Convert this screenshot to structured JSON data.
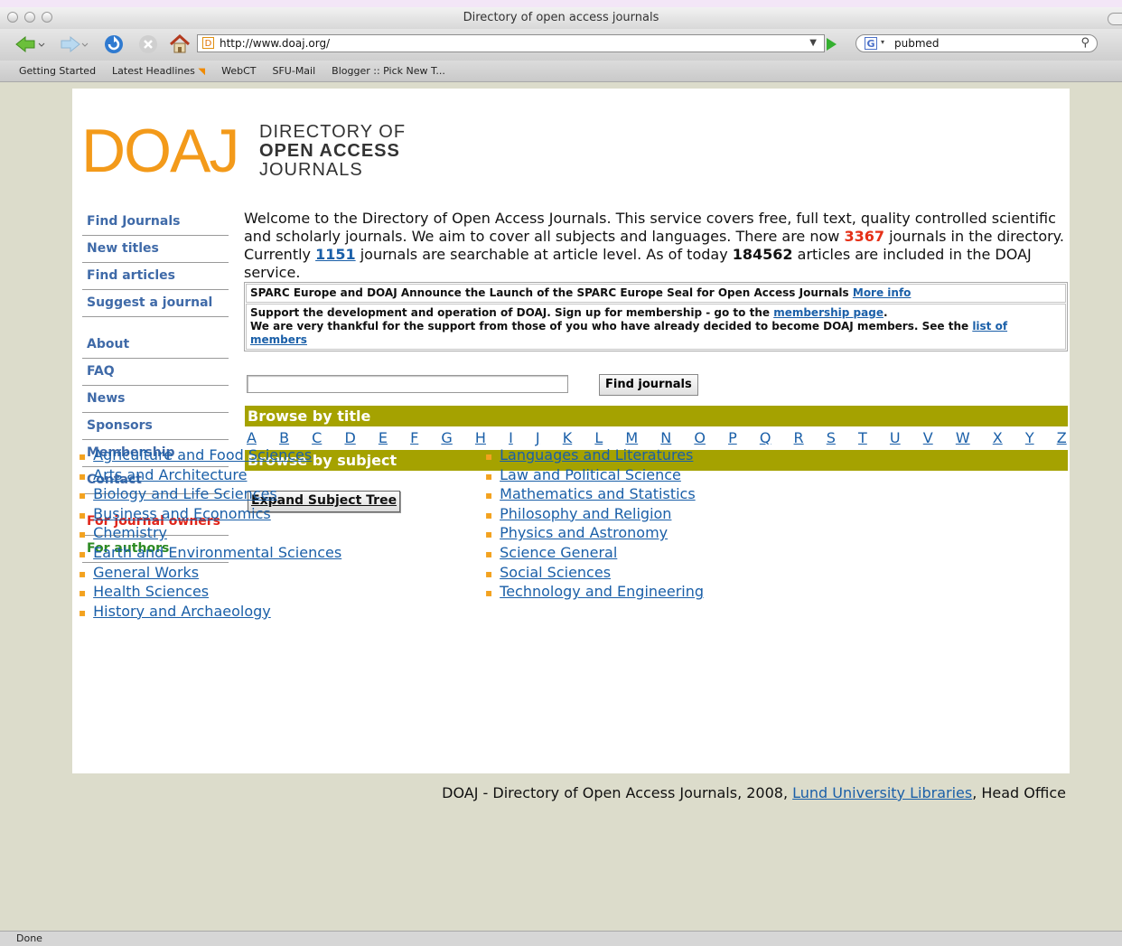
{
  "window": {
    "title": "Directory of open access journals"
  },
  "toolbar": {
    "url": "http://www.doaj.org/",
    "favicon": "D",
    "search_value": "pubmed",
    "search_engine_glyph": "G"
  },
  "bookmarks": [
    "Getting Started",
    "Latest Headlines",
    "WebCT",
    "SFU-Mail",
    "Blogger :: Pick New T..."
  ],
  "logo": {
    "mark": "DOAJ",
    "line1": "DIRECTORY OF",
    "line2": "OPEN ACCESS",
    "line3": "JOURNALS"
  },
  "sidebar": {
    "items": [
      "Find Journals",
      "New titles",
      "Find articles",
      "Suggest a journal",
      "About",
      "FAQ",
      "News",
      "Sponsors",
      "Membership",
      "Contact",
      "For journal owners",
      "For authors"
    ]
  },
  "intro": {
    "part1": "Welcome to the Directory of Open Access Journals. This service covers free, full text, quality controlled scientific and scholarly journals. We aim to cover all subjects and languages. There are now ",
    "journal_count": "3367",
    "part2": " journals in the directory. Currently ",
    "searchable_count": "1151",
    "part3": " journals are searchable at article level. As of today ",
    "article_count": "184562",
    "part4": " articles are included in the DOAJ service."
  },
  "notices": {
    "sparc_text": "SPARC Europe and DOAJ Announce the Launch of the SPARC Europe Seal for Open Access Journals ",
    "sparc_link": "More info",
    "support_text": "Support the development and operation of DOAJ. Sign up for membership - go to the ",
    "support_link": "membership page",
    "support_end": ".",
    "thanks_text": "We are very thankful for the support from those of you who have already decided to become DOAJ members. See the ",
    "thanks_link": "list of members"
  },
  "search": {
    "button": "Find journals",
    "value": ""
  },
  "browse": {
    "title_header": "Browse by title",
    "letters": [
      "A",
      "B",
      "C",
      "D",
      "E",
      "F",
      "G",
      "H",
      "I",
      "J",
      "K",
      "L",
      "M",
      "N",
      "O",
      "P",
      "Q",
      "R",
      "S",
      "T",
      "U",
      "V",
      "W",
      "X",
      "Y",
      "Z"
    ],
    "subject_header": "Browse by subject",
    "expand_button": "Expand Subject Tree"
  },
  "subjects": {
    "left": [
      "Agriculture and Food Sciences",
      "Arts and Architecture",
      "Biology and Life Sciences",
      "Business and Economics",
      "Chemistry",
      "Earth and Environmental Sciences",
      "General Works",
      "Health Sciences",
      "History and Archaeology"
    ],
    "right": [
      "Languages and Literatures",
      "Law and Political Science",
      "Mathematics and Statistics",
      "Philosophy and Religion",
      "Physics and Astronomy",
      "Science General",
      "Social Sciences",
      "Technology and Engineering"
    ]
  },
  "footer": {
    "before": "DOAJ - Directory of Open Access Journals, 2008, ",
    "link": "Lund University Libraries",
    "after": ", Head Office"
  },
  "status": {
    "text": "Done"
  },
  "colors": {
    "accent_orange": "#f39a1a",
    "bar_olive": "#a5a200",
    "link_blue": "#1a5fa8",
    "count_red": "#e53017"
  }
}
